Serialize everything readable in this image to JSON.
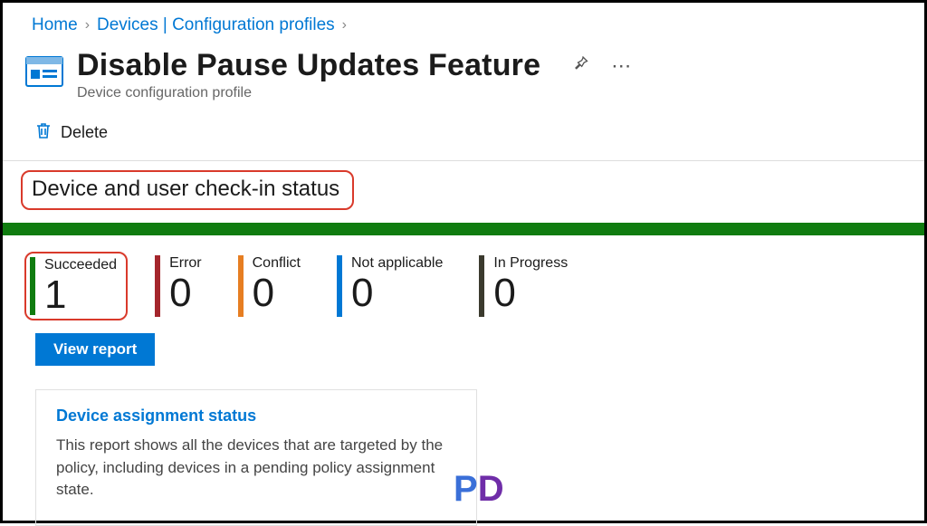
{
  "breadcrumb": {
    "home": "Home",
    "devices": "Devices | Configuration profiles"
  },
  "header": {
    "title": "Disable Pause Updates Feature",
    "subtitle": "Device configuration profile"
  },
  "toolbar": {
    "delete_label": "Delete"
  },
  "section": {
    "title": "Device and user check-in status"
  },
  "stats": {
    "succeeded": {
      "label": "Succeeded",
      "value": "1",
      "color": "#107c10"
    },
    "error": {
      "label": "Error",
      "value": "0",
      "color": "#a4262c"
    },
    "conflict": {
      "label": "Conflict",
      "value": "0",
      "color": "#e67e22"
    },
    "not_applicable": {
      "label": "Not applicable",
      "value": "0",
      "color": "#0078d4"
    },
    "in_progress": {
      "label": "In Progress",
      "value": "0",
      "color": "#3b3a2e"
    }
  },
  "buttons": {
    "view_report": "View report"
  },
  "card": {
    "title": "Device assignment status",
    "text": "This report shows all the devices that are targeted by the policy, including devices in a pending policy assignment state."
  }
}
